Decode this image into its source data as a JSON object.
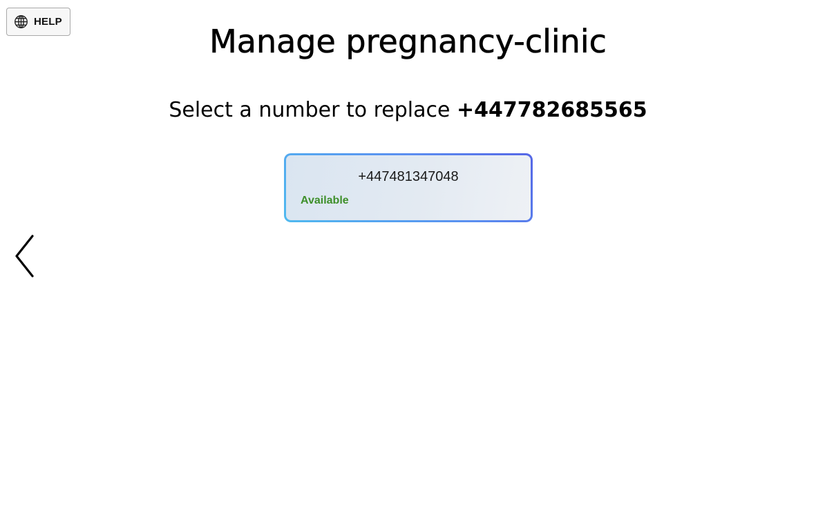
{
  "header": {
    "help_label": "HELP",
    "help_icon": "globe-icon",
    "title": "Manage pregnancy-clinic"
  },
  "prompt": {
    "text": "Select a number to replace",
    "current_number": "+447782685565"
  },
  "numbers": [
    {
      "phone": "+447481347048",
      "status": "Available",
      "status_color": "#3e8f2a"
    }
  ],
  "navigation": {
    "back_icon": "chevron-left-icon"
  },
  "colors": {
    "card_border_start": "#4fb9ef",
    "card_border_end": "#5566e6",
    "available_green": "#3e8f2a"
  }
}
